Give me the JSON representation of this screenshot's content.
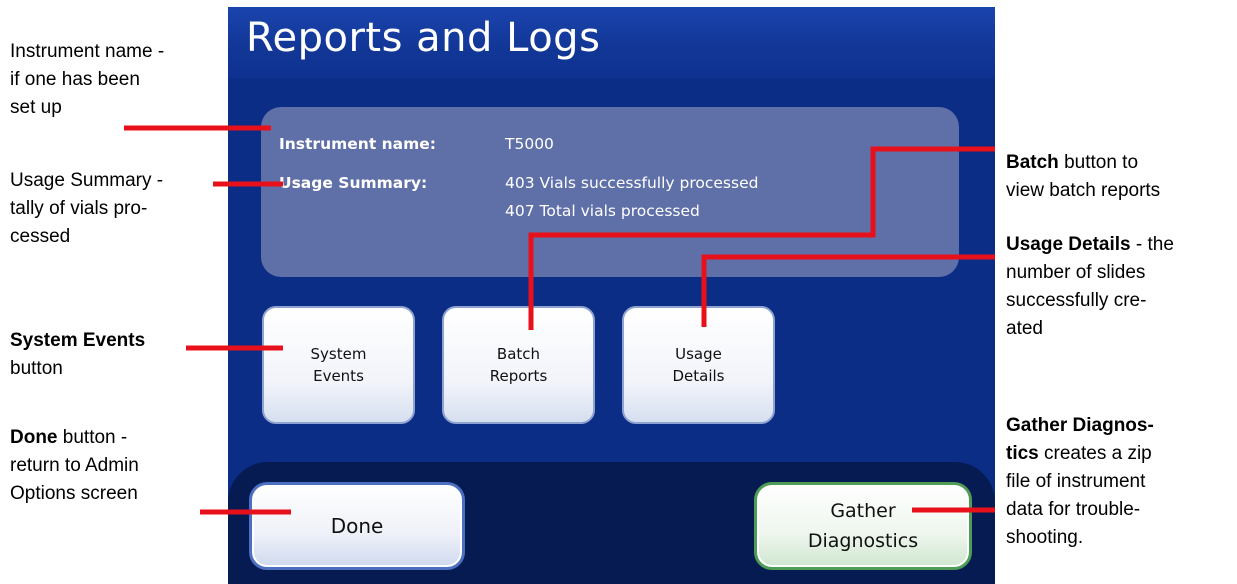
{
  "screen": {
    "title": "Reports and Logs",
    "instrument_label": "Instrument name:",
    "instrument_value": "T5000",
    "usage_label": "Usage Summary:",
    "usage_line1": "403 Vials successfully processed",
    "usage_line2": "407 Total vials processed",
    "tiles": [
      {
        "label": "System\nEvents"
      },
      {
        "label": "Batch\nReports"
      },
      {
        "label": "Usage\nDetails"
      }
    ],
    "done_label": "Done",
    "gather_label": "Gather\nDiagnostics"
  },
  "annotations": {
    "instrument_name": {
      "l1": "Instrument name -",
      "l2": "if one has been",
      "l3": "set up"
    },
    "usage_summary": {
      "l1": "Usage Summary -",
      "l2": "tally of vials pro-",
      "l3": "cessed"
    },
    "system_events": {
      "bold": "System Events",
      "rest": "button"
    },
    "done": {
      "bold": "Done",
      "rest1": " button -",
      "l2": "return to Admin",
      "l3": "Options screen"
    },
    "batch": {
      "bold": "Batch",
      "rest1": " button to",
      "l2": "view batch reports"
    },
    "usage_details": {
      "bold": "Usage Details",
      "rest1": " - the",
      "l2": "number of slides",
      "l3": "successfully cre-",
      "l4": "ated"
    },
    "gather": {
      "bold1": "Gather Diagnos-",
      "bold2": "tics",
      "rest2": " creates a zip",
      "l3": "file of instrument",
      "l4": "data for trouble-",
      "l5": "shooting."
    }
  },
  "colors": {
    "screen_bg": "#0b2d86",
    "title_bar": "#1a44ad",
    "info_box": "#5f6fa7",
    "bottom_bar": "#061b52",
    "done_border": "#4d6fc2",
    "gather_border": "#4f9c56",
    "callout_line": "#e8101a"
  }
}
